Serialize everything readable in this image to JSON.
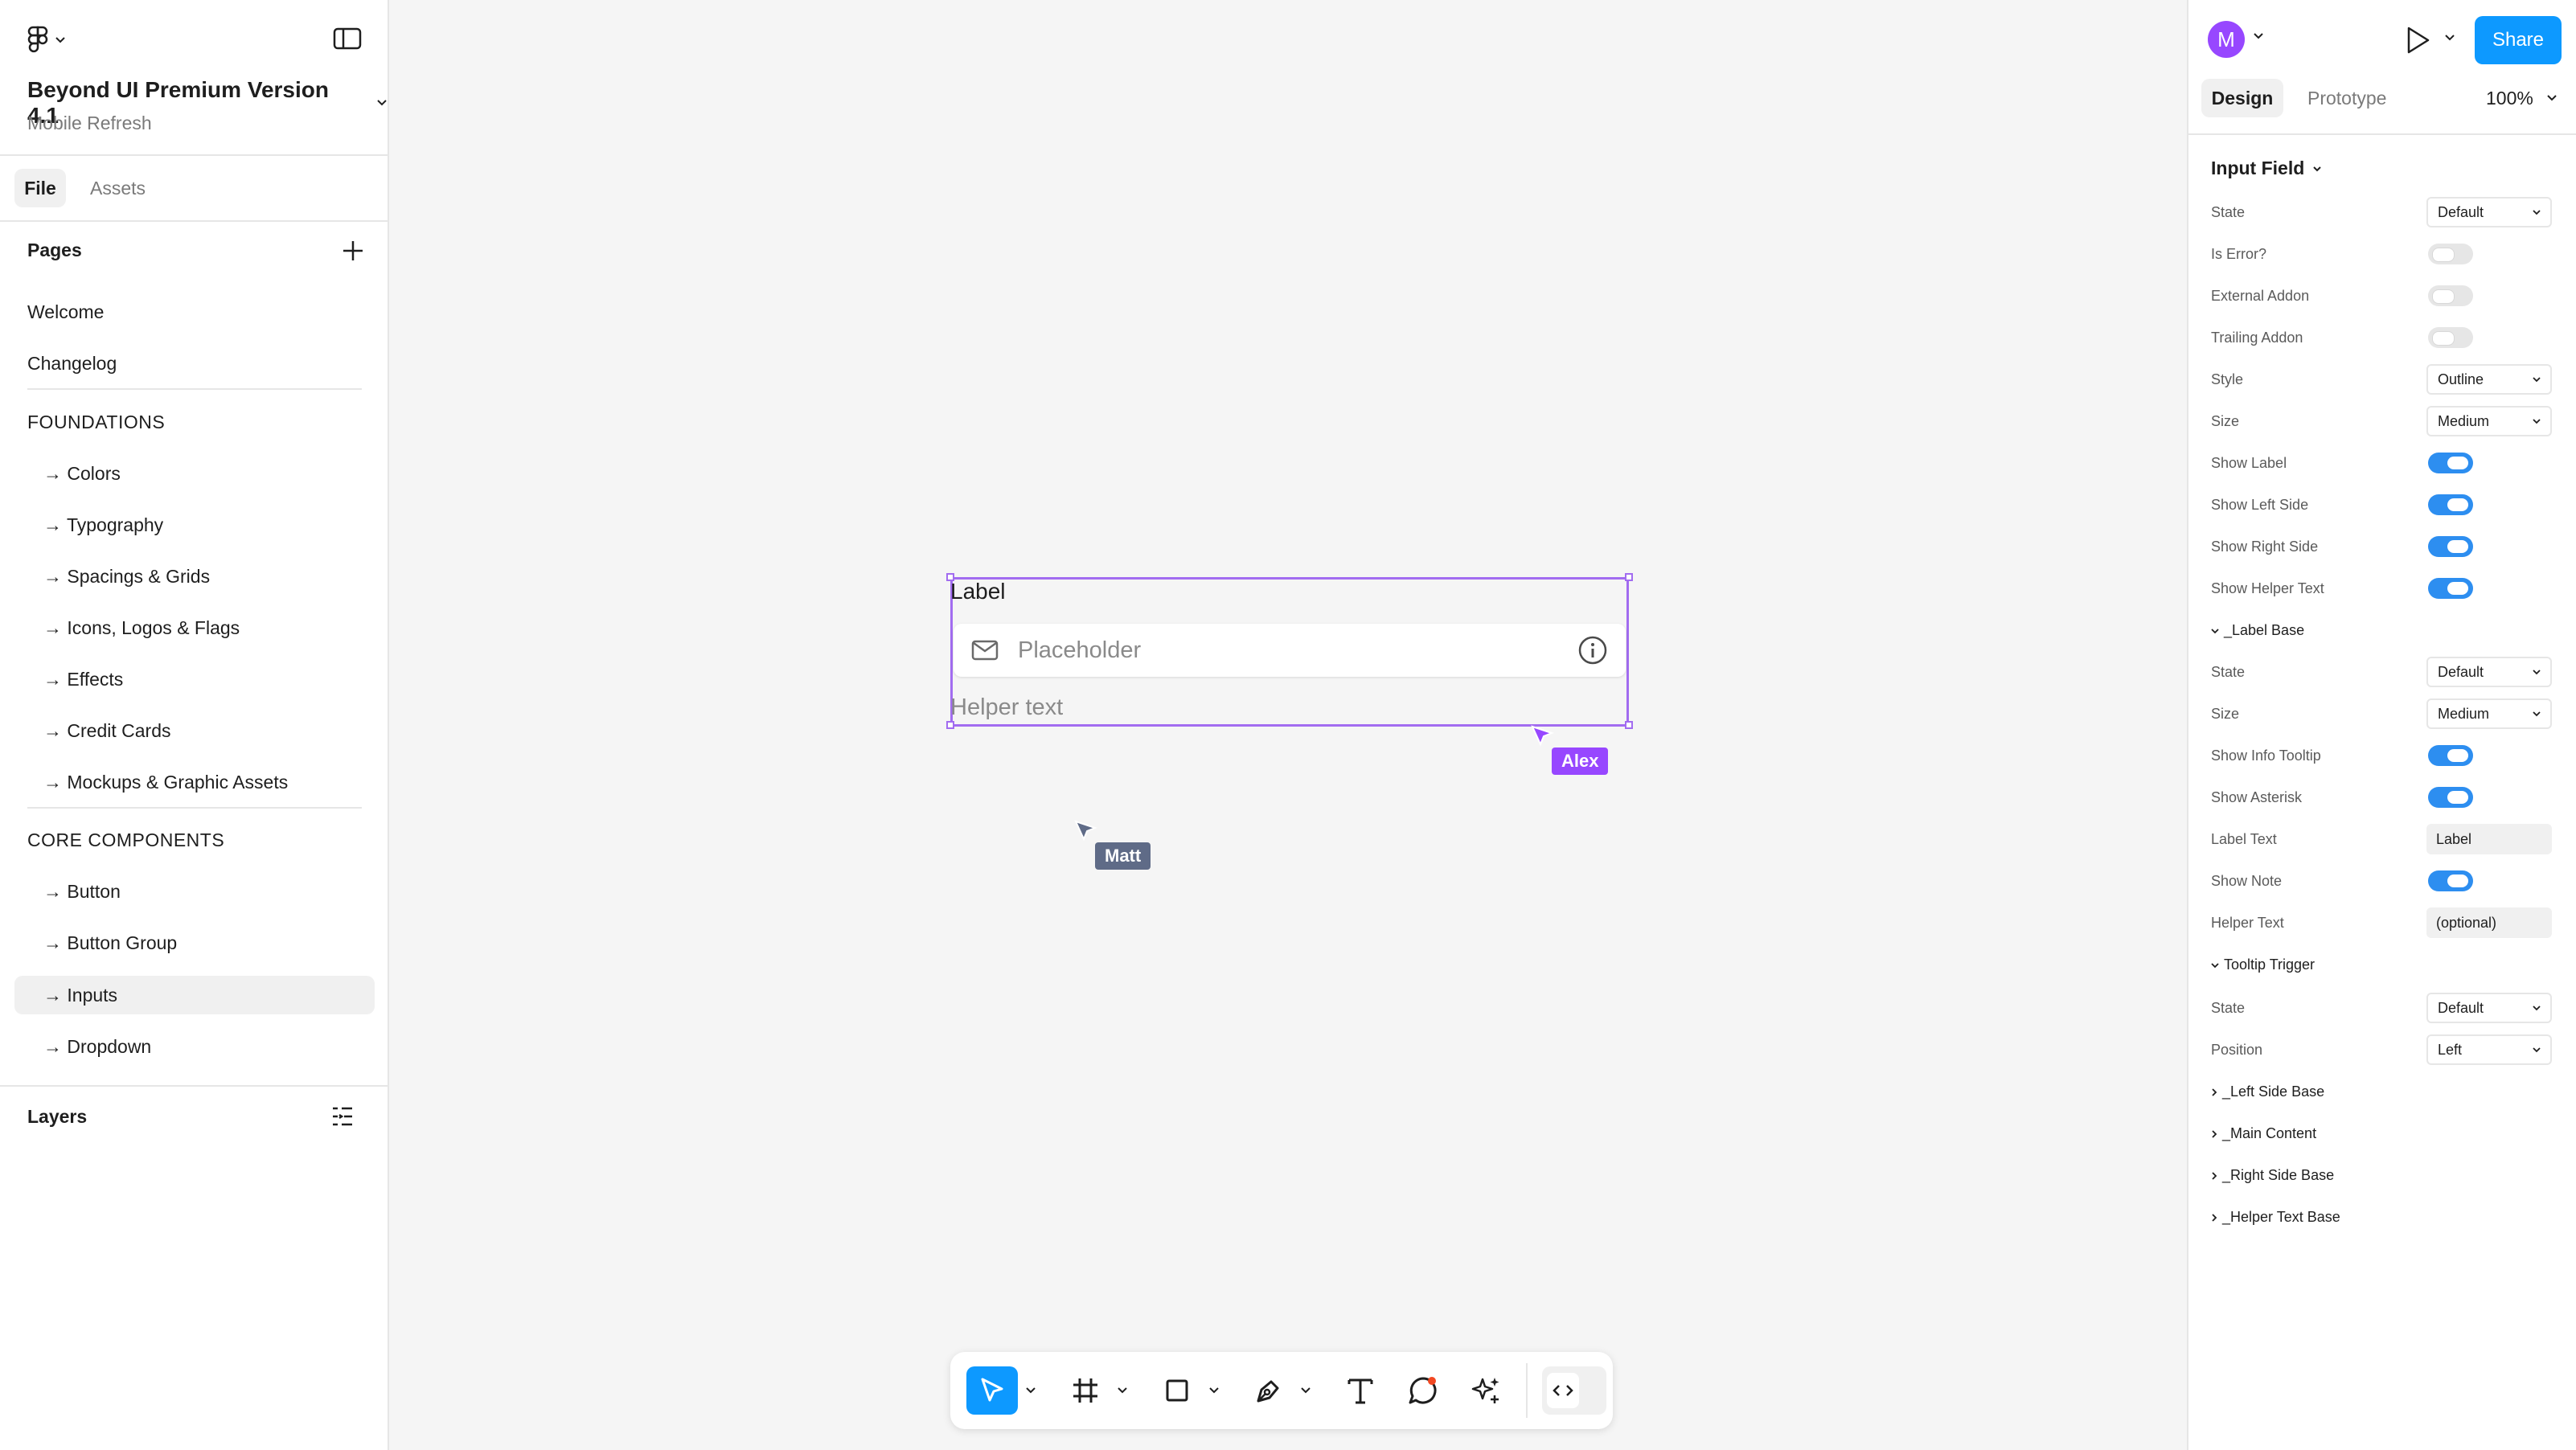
{
  "left": {
    "file_title": "Beyond UI Premium Version 4.1",
    "file_subtitle": "Mobile Refresh",
    "tabs": [
      "File",
      "Assets"
    ],
    "pages_heading": "Pages",
    "pages": [
      "Welcome",
      "Changelog",
      "FOUNDATIONS",
      "→ Colors",
      "→ Typography",
      "→ Spacings & Grids",
      "→ Icons, Logos & Flags",
      "→ Effects",
      "→ Credit Cards",
      "→ Mockups & Graphic Assets",
      "CORE COMPONENTS",
      "→ Button",
      "→ Button Group",
      "→ Inputs",
      "→ Dropdown"
    ],
    "selected_page": "→ Inputs",
    "layers_heading": "Layers"
  },
  "canvas": {
    "component": {
      "label": "Label",
      "placeholder": "Placeholder",
      "helper": "Helper text"
    },
    "cursors": [
      {
        "name": "Alex",
        "color": "#9747ff"
      },
      {
        "name": "Matt",
        "color": "#5f6b87"
      }
    ],
    "help": "?"
  },
  "right": {
    "avatar": "M",
    "share": "Share",
    "tabs": [
      "Design",
      "Prototype"
    ],
    "zoom": "100%",
    "component_name": "Input Field",
    "props": {
      "state": {
        "label": "State",
        "value": "Default"
      },
      "is_error": {
        "label": "Is Error?",
        "value": false
      },
      "external_addon": {
        "label": "External Addon",
        "value": false
      },
      "trailing_addon": {
        "label": "Trailing Addon",
        "value": false
      },
      "style": {
        "label": "Style",
        "value": "Outline"
      },
      "size": {
        "label": "Size",
        "value": "Medium"
      },
      "show_label": {
        "label": "Show Label",
        "value": true
      },
      "show_left_side": {
        "label": "Show Left Side",
        "value": true
      },
      "show_right_side": {
        "label": "Show Right Side",
        "value": true
      },
      "show_helper_text": {
        "label": "Show Helper Text",
        "value": true
      }
    },
    "label_base": {
      "heading": "_Label Base",
      "state": {
        "label": "State",
        "value": "Default"
      },
      "size": {
        "label": "Size",
        "value": "Medium"
      },
      "show_info_tooltip": {
        "label": "Show Info Tooltip",
        "value": true
      },
      "show_asterisk": {
        "label": "Show Asterisk",
        "value": true
      },
      "label_text": {
        "label": "Label Text",
        "value": "Label"
      },
      "show_note": {
        "label": "Show Note",
        "value": true
      },
      "helper_text": {
        "label": "Helper Text",
        "value": "(optional)"
      }
    },
    "tooltip_trigger": {
      "heading": "Tooltip Trigger",
      "state": {
        "label": "State",
        "value": "Default"
      },
      "position": {
        "label": "Position",
        "value": "Left"
      }
    },
    "collapsed": [
      "_Left Side Base",
      "_Main Content",
      "_Right Side Base",
      "_Helper Text Base"
    ]
  },
  "colors": {
    "accent": "#0d99ff",
    "selection": "#a26cf0",
    "toggle_on": "#2d8ef0"
  }
}
